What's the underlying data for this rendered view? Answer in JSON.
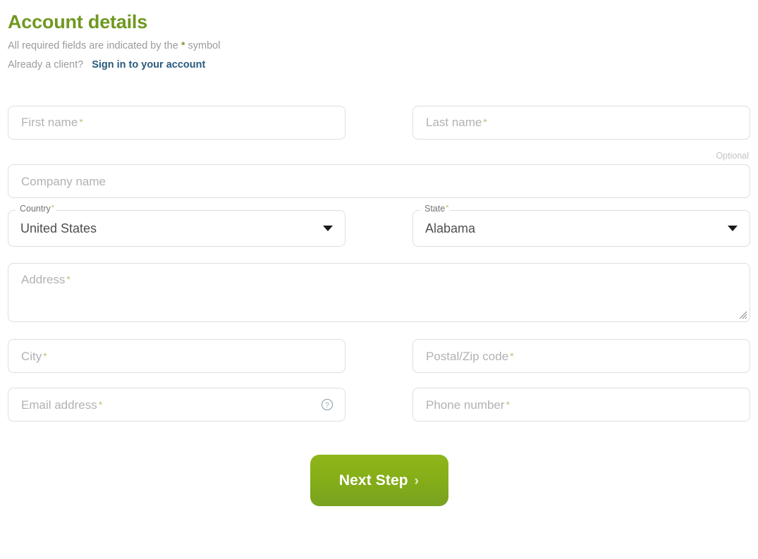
{
  "header": {
    "title": "Account details",
    "required_note_prefix": "All required fields are indicated by the ",
    "required_note_star": "*",
    "required_note_suffix": " symbol",
    "already_client_text": "Already a client?",
    "signin_link": "Sign in to your account"
  },
  "colors": {
    "title_green": "#6f9821",
    "link_blue": "#2a5a7d",
    "required_star": "#bcc275",
    "button_gradient_top": "#8fb619",
    "button_gradient_bottom": "#78a220",
    "field_border": "#dedede",
    "placeholder_text": "#b2b2b2"
  },
  "form": {
    "first_name": {
      "placeholder": "First name",
      "value": "",
      "required": true
    },
    "last_name": {
      "placeholder": "Last name",
      "value": "",
      "required": true
    },
    "optional_tag": "Optional",
    "company_name": {
      "placeholder": "Company name",
      "value": "",
      "required": false
    },
    "country": {
      "label": "Country",
      "value": "United States",
      "required": true,
      "caret_icon": "chevron-down-icon"
    },
    "state": {
      "label": "State",
      "value": "Alabama",
      "required": true,
      "caret_icon": "chevron-down-icon"
    },
    "address": {
      "placeholder": "Address",
      "value": "",
      "required": true,
      "resize_icon": "resize-grip-icon"
    },
    "city": {
      "placeholder": "City",
      "value": "",
      "required": true
    },
    "postal_code": {
      "placeholder": "Postal/Zip code",
      "value": "",
      "required": true
    },
    "email": {
      "placeholder": "Email address",
      "value": "",
      "required": true,
      "help_icon": "question-mark-circle-icon"
    },
    "phone": {
      "placeholder": "Phone number",
      "value": "",
      "required": true
    },
    "star_symbol": "*"
  },
  "actions": {
    "next_step_label": "Next Step",
    "next_step_chevron": "›"
  }
}
